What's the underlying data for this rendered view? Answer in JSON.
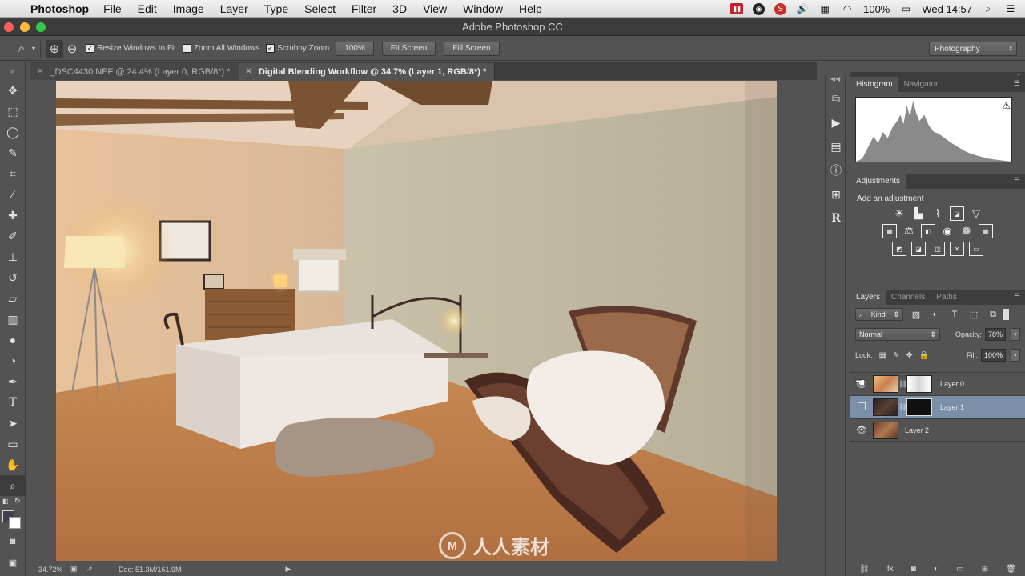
{
  "menubar": {
    "app": "Photoshop",
    "items": [
      "File",
      "Edit",
      "Image",
      "Layer",
      "Type",
      "Select",
      "Filter",
      "3D",
      "View",
      "Window",
      "Help"
    ],
    "battery": "100%",
    "clock": "Wed 14:57"
  },
  "window": {
    "title": "Adobe Photoshop CC"
  },
  "options": {
    "resize_windows": "Resize Windows to Fit",
    "zoom_all": "Zoom All Windows",
    "scrubby": "Scrubby Zoom",
    "zoom_value": "100%",
    "fit_screen": "Fit Screen",
    "fill_screen": "Fill Screen",
    "workspace": "Photography"
  },
  "tabs": [
    {
      "label": "_DSC4430.NEF @ 24.4% (Layer 0, RGB/8*) *",
      "active": false
    },
    {
      "label": "Digital Blending Workflow @ 34.7% (Layer 1, RGB/8*) *",
      "active": true
    }
  ],
  "status": {
    "zoom": "34.72%",
    "doc": "Doc: 51.3M/161.9M"
  },
  "histogram_panel": {
    "tabs": [
      "Histogram",
      "Navigator"
    ]
  },
  "adjustments_panel": {
    "title": "Adjustments",
    "subtitle": "Add an adjustment"
  },
  "layers_panel": {
    "tabs": [
      "Layers",
      "Channels",
      "Paths"
    ],
    "kind_filter": "Kind",
    "blend_mode": "Normal",
    "opacity_label": "Opacity:",
    "opacity_value": "78%",
    "lock_label": "Lock:",
    "fill_label": "Fill:",
    "fill_value": "100%",
    "layers": [
      {
        "name": "Layer 0",
        "visible": true,
        "selected": false
      },
      {
        "name": "Layer 1",
        "visible": false,
        "selected": true
      },
      {
        "name": "Layer 2",
        "visible": true,
        "selected": false
      }
    ]
  },
  "watermark": {
    "text": "人人素材"
  },
  "colors": {
    "accent_selected_layer": "#7b8fa8",
    "ui_bg": "#535353",
    "panel_tab_bg": "#3d3d3d"
  }
}
